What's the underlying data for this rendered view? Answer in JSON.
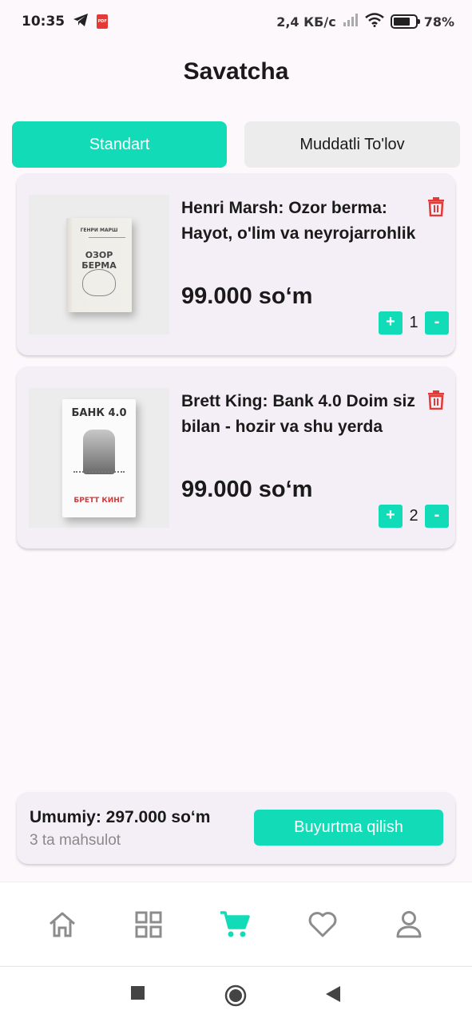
{
  "status_bar": {
    "time": "10:35",
    "pdf_label": "PDF",
    "network_speed": "2,4 КБ/с",
    "battery_percent": "78%",
    "battery_level": 0.78
  },
  "header": {
    "title": "Savatcha"
  },
  "tabs": [
    {
      "label": "Standart",
      "active": true
    },
    {
      "label": "Muddatli To'lov",
      "active": false
    }
  ],
  "cart_items": [
    {
      "name": "Henri Marsh: Ozor berma: Hayot, o'lim va neyrojarrohlik",
      "price": "99.000 so‘m",
      "quantity": "1",
      "cover": {
        "author": "ГЕНРИ МАРШ",
        "title": "ОЗОР БЕРМА"
      }
    },
    {
      "name": "Brett King: Bank 4.0 Doim siz bilan - hozir va shu yerda",
      "price": "99.000 so‘m",
      "quantity": "2",
      "cover": {
        "title": "БАНК 4.0",
        "author": "БРЕТТ КИНГ"
      }
    }
  ],
  "qty_controls": {
    "increase": "+",
    "decrease": "-"
  },
  "summary": {
    "total": "Umumiy: 297.000 so‘m",
    "count": "3 ta mahsulot",
    "order_button": "Buyurtma qilish"
  },
  "colors": {
    "accent": "#12dbb8",
    "delete": "#e53935",
    "card_bg": "#f4eff6",
    "page_bg": "#fdf8fc"
  },
  "bottom_nav": {
    "items": [
      "home-icon",
      "grid-icon",
      "cart-icon",
      "heart-icon",
      "person-icon"
    ],
    "active": "cart-icon"
  }
}
